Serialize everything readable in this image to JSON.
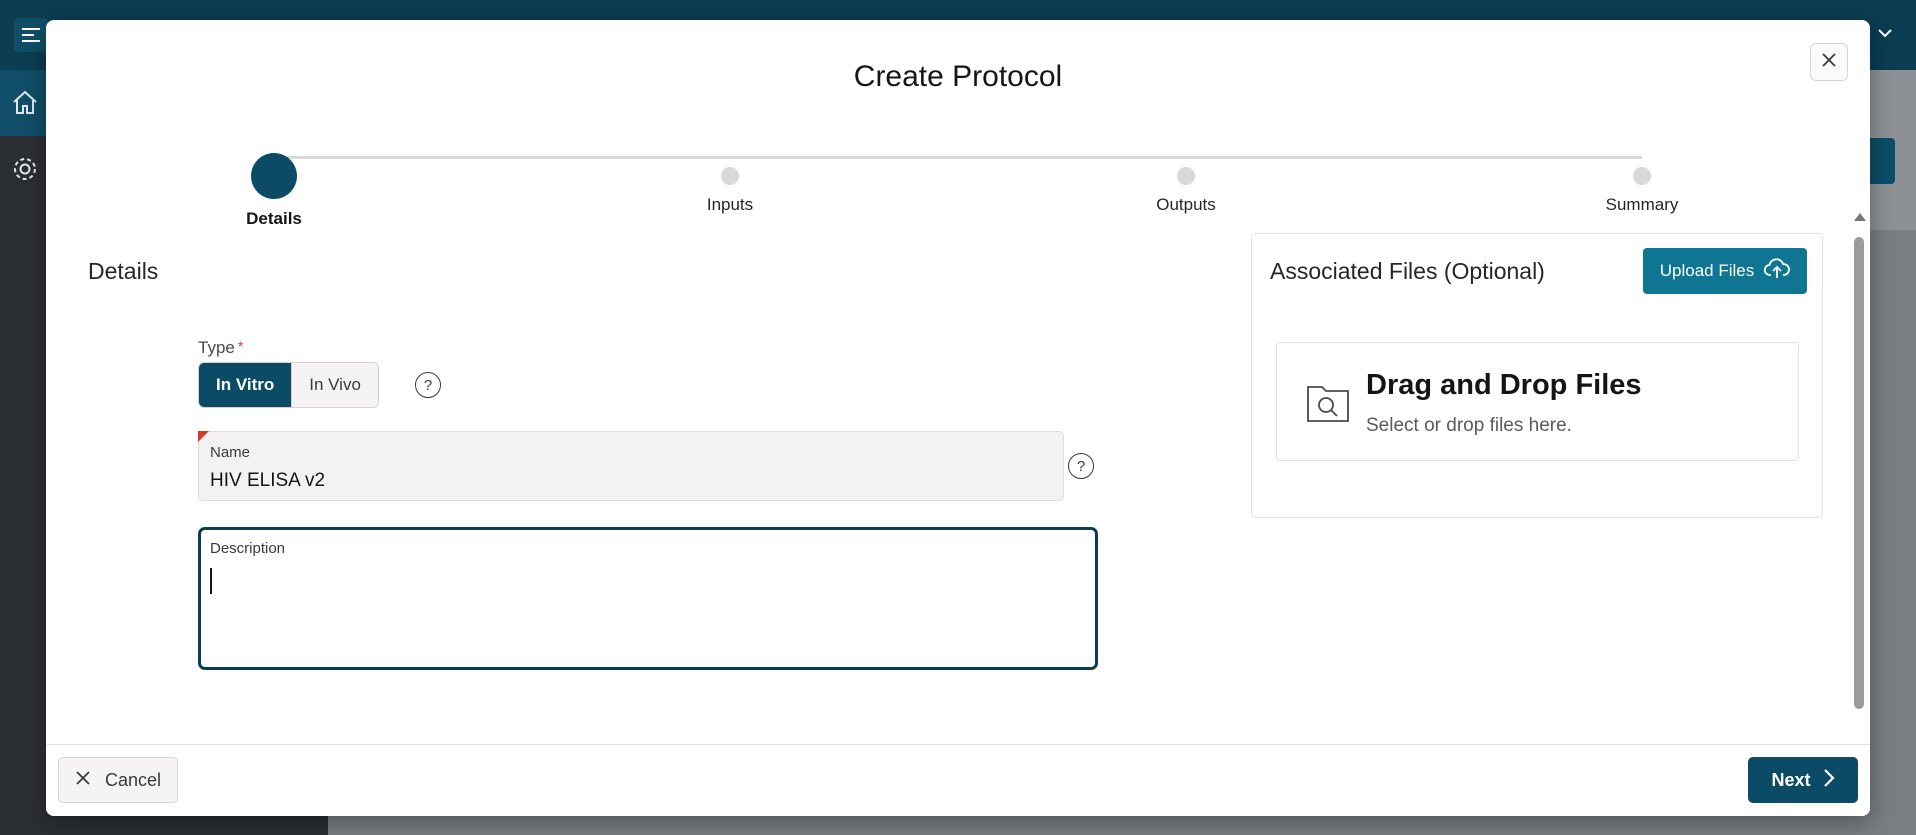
{
  "dialog": {
    "title": "Create Protocol"
  },
  "stepper": {
    "steps": [
      {
        "label": "Details",
        "active": true
      },
      {
        "label": "Inputs",
        "active": false
      },
      {
        "label": "Outputs",
        "active": false
      },
      {
        "label": "Summary",
        "active": false
      }
    ]
  },
  "details": {
    "section_title": "Details",
    "type_label": "Type",
    "type_required_mark": "*",
    "type_options": [
      "In Vitro",
      "In Vivo"
    ],
    "type_selected": "In Vitro",
    "help_glyph": "?",
    "name_label": "Name",
    "name_value": "HIV ELISA v2",
    "description_label": "Description",
    "description_value": ""
  },
  "files": {
    "title": "Associated Files (Optional)",
    "upload_label": "Upload Files",
    "drop_title": "Drag and Drop Files",
    "drop_subtitle": "Select or drop files here."
  },
  "footer": {
    "cancel_label": "Cancel",
    "next_label": "Next"
  },
  "colors": {
    "primary": "#0b4b66",
    "upload": "#0e7592",
    "required": "#d63b25"
  },
  "icons": [
    "menu-icon",
    "home-icon",
    "gear-icon",
    "close-icon",
    "help-icon",
    "cloud-upload-icon",
    "folder-search-icon",
    "chevron-right-icon",
    "chevron-down-icon"
  ]
}
